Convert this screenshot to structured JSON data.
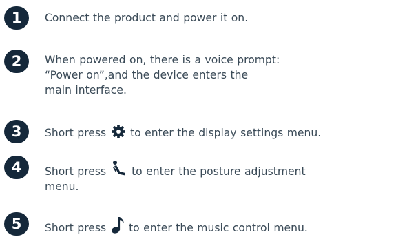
{
  "steps": [
    {
      "number": "1",
      "text": "Connect the product and power it on."
    },
    {
      "number": "2",
      "lines": [
        "When powered on, there is a voice prompt:",
        "“Power on”,and the device enters the",
        "main interface."
      ]
    },
    {
      "number": "3",
      "before": "Short press",
      "icon": "gear-icon",
      "after": "to enter the display settings menu."
    },
    {
      "number": "4",
      "before": "Short press",
      "icon": "posture-icon",
      "after_line1": "to enter the posture adjustment",
      "after_line2": "menu."
    },
    {
      "number": "5",
      "before": "Short press",
      "icon": "music-note-icon",
      "after": "to enter the music control menu."
    }
  ],
  "colors": {
    "badge": "#15283a",
    "text": "#3a4a57"
  }
}
